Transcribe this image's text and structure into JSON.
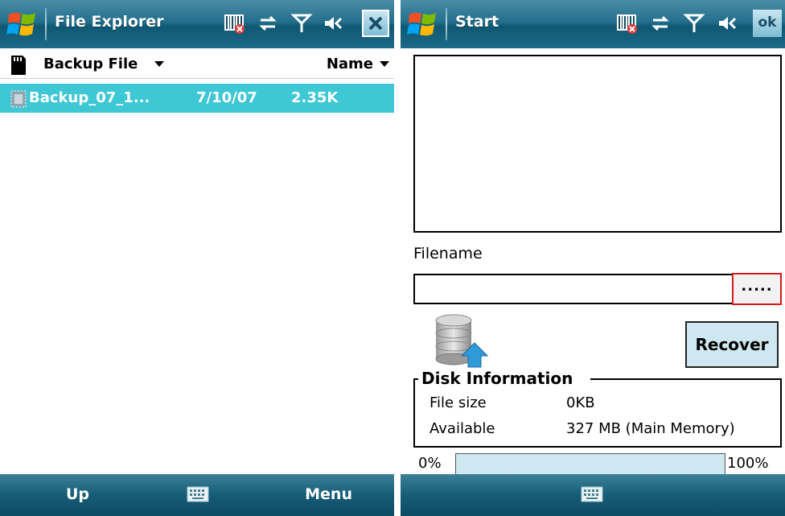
{
  "left_window": {
    "title": "File Explorer",
    "folder": "Backup File",
    "sort": "Name",
    "files": [
      {
        "name": "Backup_07_1...",
        "date": "7/10/07",
        "size": "2.35K",
        "selected": true
      }
    ],
    "softkeys": {
      "left": "Up",
      "right": "Menu"
    }
  },
  "right_window": {
    "title": "Start",
    "ok_label": "ok",
    "filename_label": "Filename",
    "filename_value": "",
    "browse_label": ".....",
    "recover_label": "Recover",
    "disk_info": {
      "title": "Disk Information",
      "file_size_label": "File size",
      "file_size_value": "0KB",
      "available_label": "Available",
      "available_value": "327 MB (Main Memory)"
    },
    "progress": {
      "min_label": "0%",
      "max_label": "100%",
      "value": 0
    }
  },
  "colors": {
    "titlebar": "#236f8c",
    "selection": "#3ec7d4",
    "button_fill": "#cfe7f0",
    "browse_border": "#d41a1a"
  },
  "icons": {
    "start": "windows-flag-icon",
    "status": [
      "barcode-icon",
      "sync-icon",
      "signal-icon",
      "volume-icon"
    ],
    "close": "close-icon",
    "storage": "sd-card-icon",
    "file": "backup-file-icon",
    "database": "database-restore-icon",
    "keyboard": "keyboard-icon"
  }
}
